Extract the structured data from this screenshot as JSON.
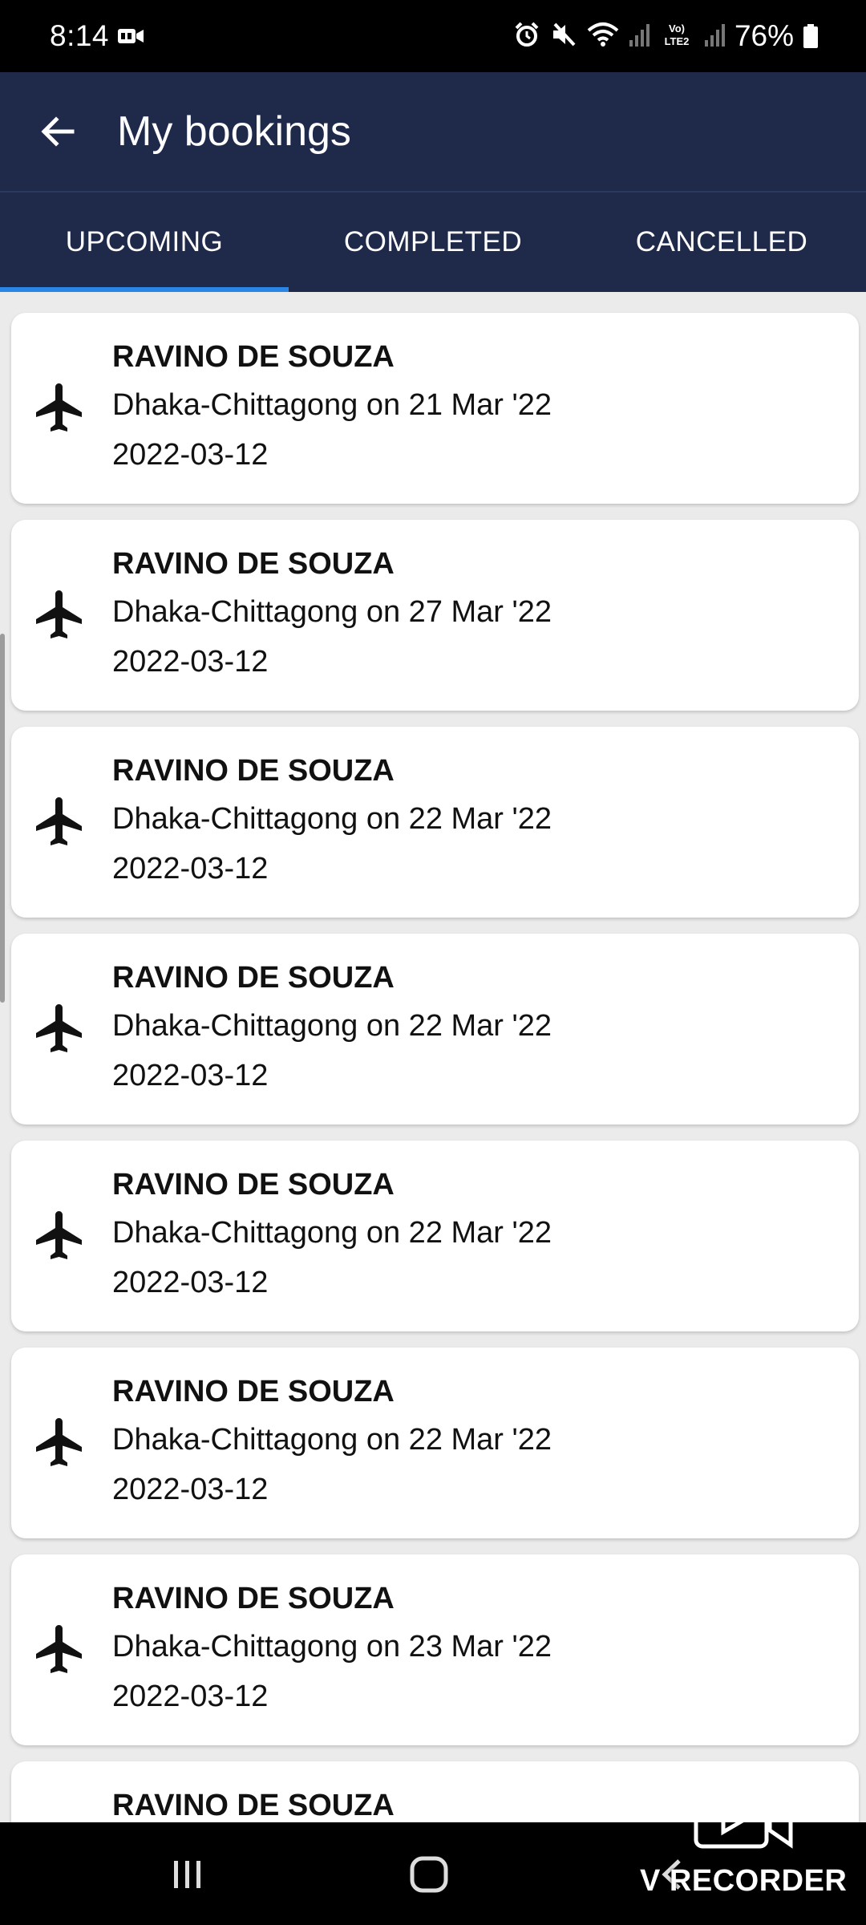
{
  "status_bar": {
    "time": "8:14",
    "battery": "76%",
    "network_label": "Vo) LTE2",
    "icons": [
      "video-recording-icon",
      "alarm-icon",
      "mute-icon",
      "wifi-icon",
      "signal-icon",
      "lte-icon",
      "signal-icon",
      "battery-icon"
    ]
  },
  "app_bar": {
    "title": "My bookings",
    "back_icon": "arrow-left-icon"
  },
  "tabs": [
    {
      "label": "UPCOMING",
      "active": true
    },
    {
      "label": "COMPLETED",
      "active": false
    },
    {
      "label": "CANCELLED",
      "active": false
    }
  ],
  "bookings": [
    {
      "name": "RAVINO DE SOUZA",
      "route": "Dhaka-Chittagong on 21 Mar '22",
      "date": "2022-03-12",
      "icon": "airplane-icon"
    },
    {
      "name": "RAVINO DE SOUZA",
      "route": "Dhaka-Chittagong on 27 Mar '22",
      "date": "2022-03-12",
      "icon": "airplane-icon"
    },
    {
      "name": "RAVINO DE SOUZA",
      "route": "Dhaka-Chittagong on 22 Mar '22",
      "date": "2022-03-12",
      "icon": "airplane-icon"
    },
    {
      "name": "RAVINO DE SOUZA",
      "route": "Dhaka-Chittagong on 22 Mar '22",
      "date": "2022-03-12",
      "icon": "airplane-icon"
    },
    {
      "name": "RAVINO DE SOUZA",
      "route": "Dhaka-Chittagong on 22 Mar '22",
      "date": "2022-03-12",
      "icon": "airplane-icon"
    },
    {
      "name": "RAVINO DE SOUZA",
      "route": "Dhaka-Chittagong on 22 Mar '22",
      "date": "2022-03-12",
      "icon": "airplane-icon"
    },
    {
      "name": "RAVINO DE SOUZA",
      "route": "Dhaka-Chittagong on 23 Mar '22",
      "date": "2022-03-12",
      "icon": "airplane-icon"
    },
    {
      "name": "RAVINO DE SOUZA",
      "route": "",
      "date": "",
      "icon": "airplane-icon"
    }
  ],
  "nav_bar": {
    "icons": [
      "recent-apps-icon",
      "home-icon",
      "back-icon"
    ]
  },
  "watermark": {
    "text": "V RECORDER"
  },
  "colors": {
    "app_bar": "#1f2a4b",
    "tab_indicator": "#2a86e6",
    "background": "#ebebeb",
    "card": "#ffffff"
  }
}
